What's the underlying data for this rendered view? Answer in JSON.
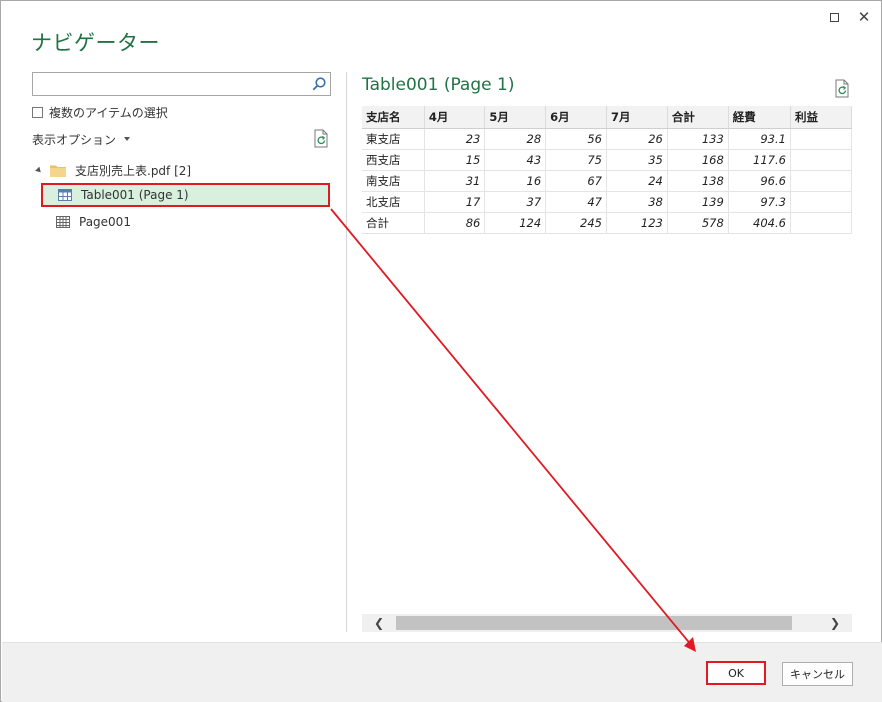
{
  "dialog": {
    "title": "ナビゲーター",
    "maximize_icon": "maximize-icon",
    "close_icon": "close-icon",
    "close_glyph": "✕"
  },
  "left_pane": {
    "search": {
      "value": "",
      "placeholder": ""
    },
    "multi_select_label": "複数のアイテムの選択",
    "view_options_label": "表示オプション",
    "tree": {
      "folder_label": "支店別売上表.pdf [2]",
      "items": [
        {
          "label": "Table001 (Page 1)",
          "icon": "table-icon",
          "selected": true
        },
        {
          "label": "Page001",
          "icon": "page-table-icon",
          "selected": false
        }
      ]
    }
  },
  "preview": {
    "title": "Table001 (Page 1)",
    "columns": [
      "支店名",
      "4月",
      "5月",
      "6月",
      "7月",
      "合計",
      "経費",
      "利益"
    ],
    "rows": [
      [
        "東支店",
        "23",
        "28",
        "56",
        "26",
        "133",
        "93.1",
        ""
      ],
      [
        "西支店",
        "15",
        "43",
        "75",
        "35",
        "168",
        "117.6",
        ""
      ],
      [
        "南支店",
        "31",
        "16",
        "67",
        "24",
        "138",
        "96.6",
        ""
      ],
      [
        "北支店",
        "17",
        "37",
        "47",
        "38",
        "139",
        "97.3",
        ""
      ],
      [
        "合計",
        "86",
        "124",
        "245",
        "123",
        "578",
        "404.6",
        ""
      ]
    ],
    "scroll_left_glyph": "❮",
    "scroll_right_glyph": "❯"
  },
  "footer": {
    "ok_label": "OK",
    "cancel_label": "キャンセル"
  },
  "colors": {
    "accent": "#217346",
    "highlight": "#e01a22",
    "selected_bg": "#d9f0df"
  }
}
